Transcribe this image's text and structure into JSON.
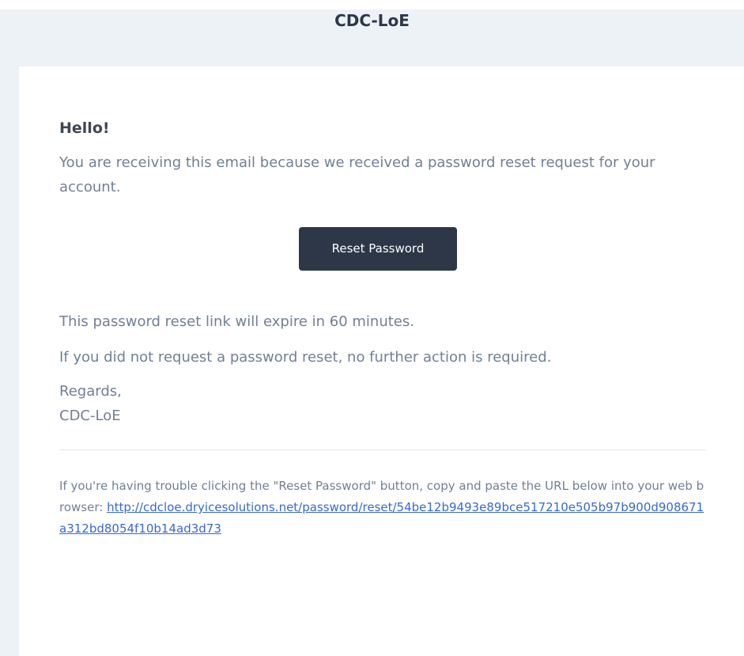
{
  "header": {
    "title": "CDC-LoE"
  },
  "email": {
    "greeting": "Hello!",
    "intro": "You are receiving this email because we received a password reset request for your account.",
    "button_label": "Reset Password",
    "expire_notice": "This password reset link will expire in 60 minutes.",
    "no_action": "If you did not request a password reset, no further action is required.",
    "regards_line": "Regards,",
    "signature": "CDC-LoE"
  },
  "subcopy": {
    "text": "If you're having trouble clicking the \"Reset Password\" button, copy and paste the URL below into your web browser: ",
    "url": "http://cdcloe.dryicesolutions.net/password/reset/54be12b9493e89bce517210e505b97b900d908671a312bd8054f10b14ad3d73"
  },
  "colors": {
    "background": "#edf2f7",
    "card": "#ffffff",
    "button": "#2d3748",
    "text_muted": "#718096",
    "heading": "#3d4852",
    "link": "#3869d4"
  }
}
